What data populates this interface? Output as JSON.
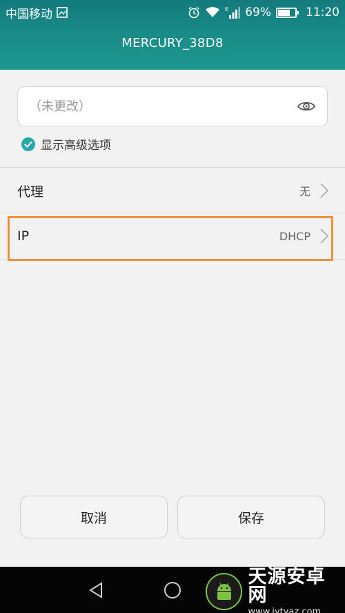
{
  "status_bar": {
    "carrier": "中国移动",
    "battery_percent": "69%",
    "battery_level": 0.69,
    "time": "11:20",
    "signal_type": "E"
  },
  "header": {
    "title": "MERCURY_38D8"
  },
  "password": {
    "placeholder": "（未更改）"
  },
  "advanced": {
    "label": "显示高级选项",
    "checked": true
  },
  "rows": [
    {
      "label": "代理",
      "value": "无"
    },
    {
      "label": "IP",
      "value": "DHCP"
    }
  ],
  "buttons": {
    "cancel": "取消",
    "save": "保存"
  },
  "watermark": {
    "title": "天源安卓网",
    "url": "www.jytyaz.com"
  },
  "colors": {
    "header": "#1a8f8a",
    "accent": "#27a9a9",
    "highlight": "#f0903a"
  }
}
